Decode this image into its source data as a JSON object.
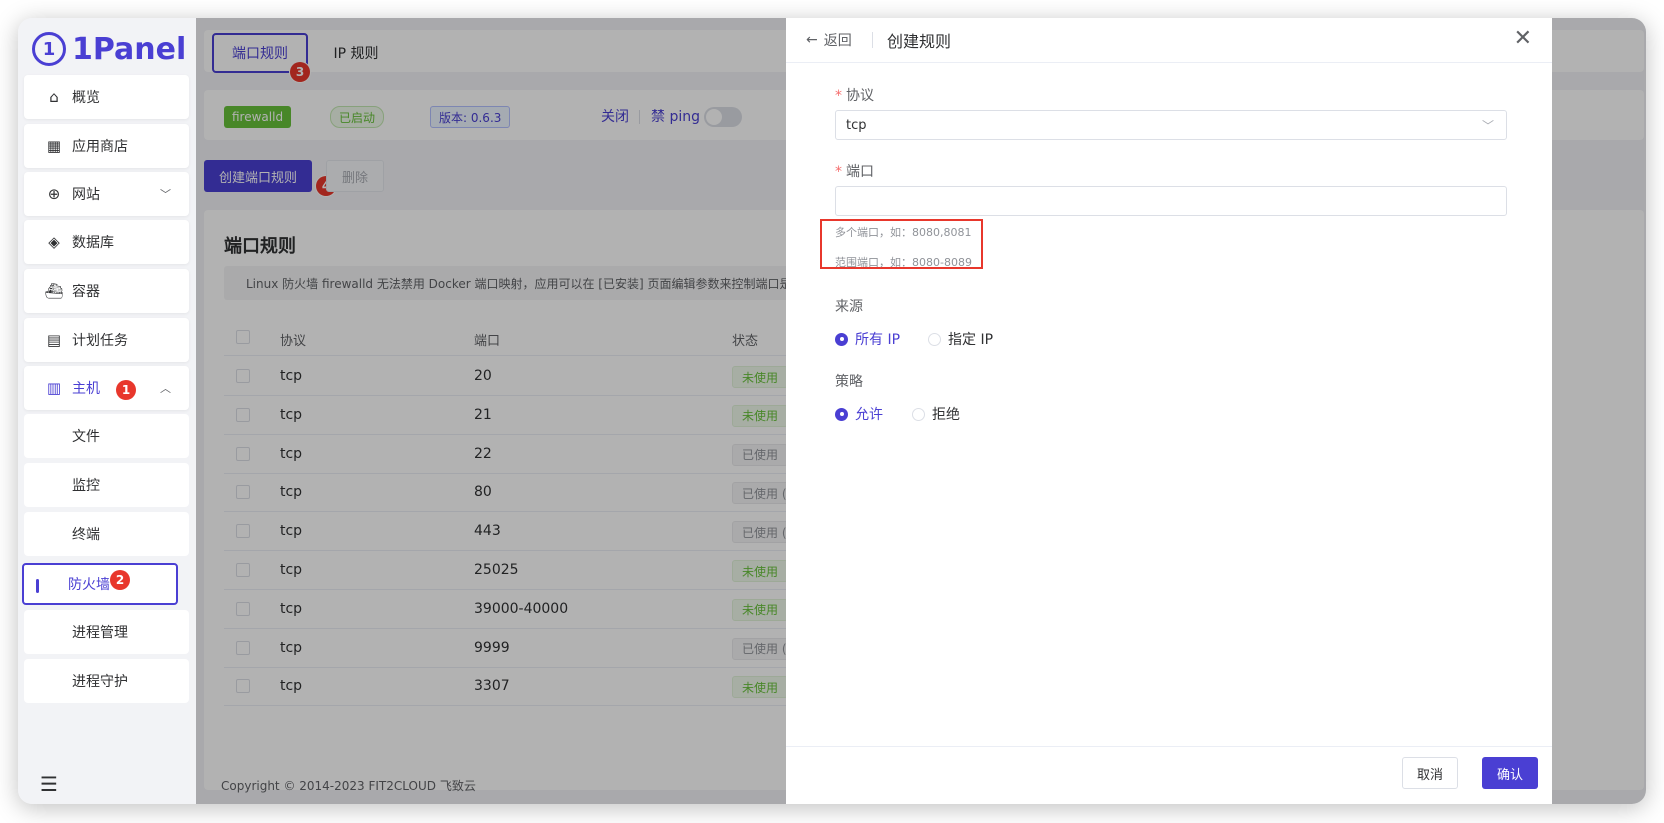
{
  "brand": {
    "logo_text": "1Panel",
    "accent": "#4a3fd3",
    "badge_color": "#e8372c"
  },
  "sidebar": {
    "items": [
      {
        "label": "概览",
        "icon": "home-icon"
      },
      {
        "label": "应用商店",
        "icon": "grid-icon"
      },
      {
        "label": "网站",
        "icon": "globe-icon"
      },
      {
        "label": "数据库",
        "icon": "layers-icon"
      },
      {
        "label": "容器",
        "icon": "docker-icon"
      },
      {
        "label": "计划任务",
        "icon": "calendar-icon"
      },
      {
        "label": "主机",
        "icon": "server-icon"
      }
    ],
    "sub_items": [
      "文件",
      "监控",
      "终端",
      "防火墙",
      "进程管理",
      "进程守护"
    ],
    "badges": {
      "host": "1",
      "firewall": "2"
    }
  },
  "tabs": {
    "port_rules": "端口规则",
    "ip_rules": "IP 规则",
    "badge": "3"
  },
  "status": {
    "firewall_name": "firewalld",
    "running": "已启动",
    "version": "版本: 0.6.3",
    "close": "关闭",
    "ban_ping": "禁 ping"
  },
  "toolbar": {
    "create": "创建端口规则",
    "create_badge": "4",
    "delete": "删除"
  },
  "panel": {
    "title": "端口规则",
    "notice": "Linux 防火墙 firewalld 无法禁用 Docker 端口映射，应用可以在 [已安装] 页面编辑参数来控制端口是否放开",
    "columns": [
      "协议",
      "端口",
      "状态"
    ],
    "rows": [
      {
        "protocol": "tcp",
        "port": "20",
        "status": "未使用",
        "used": false
      },
      {
        "protocol": "tcp",
        "port": "21",
        "status": "未使用",
        "used": false
      },
      {
        "protocol": "tcp",
        "port": "22",
        "status": "已使用",
        "used": true
      },
      {
        "protocol": "tcp",
        "port": "80",
        "status": "已使用 (",
        "used": true
      },
      {
        "protocol": "tcp",
        "port": "443",
        "status": "已使用 (",
        "used": true
      },
      {
        "protocol": "tcp",
        "port": "25025",
        "status": "未使用",
        "used": false
      },
      {
        "protocol": "tcp",
        "port": "39000-40000",
        "status": "未使用",
        "used": false
      },
      {
        "protocol": "tcp",
        "port": "9999",
        "status": "已使用 (",
        "used": true
      },
      {
        "protocol": "tcp",
        "port": "3307",
        "status": "未使用",
        "used": false
      }
    ]
  },
  "footer": {
    "copyright": "Copyright © 2014-2023 FIT2CLOUD 飞致云"
  },
  "drawer": {
    "back": "返回",
    "title": "创建规则",
    "protocol_label": "协议",
    "protocol_value": "tcp",
    "port_label": "端口",
    "port_value": "",
    "hint_multi": "多个端口，如：8080,8081",
    "hint_range": "范围端口，如：8080-8089",
    "source_label": "来源",
    "source_options": [
      "所有 IP",
      "指定 IP"
    ],
    "strategy_label": "策略",
    "strategy_options": [
      "允许",
      "拒绝"
    ],
    "cancel": "取消",
    "confirm": "确认"
  }
}
